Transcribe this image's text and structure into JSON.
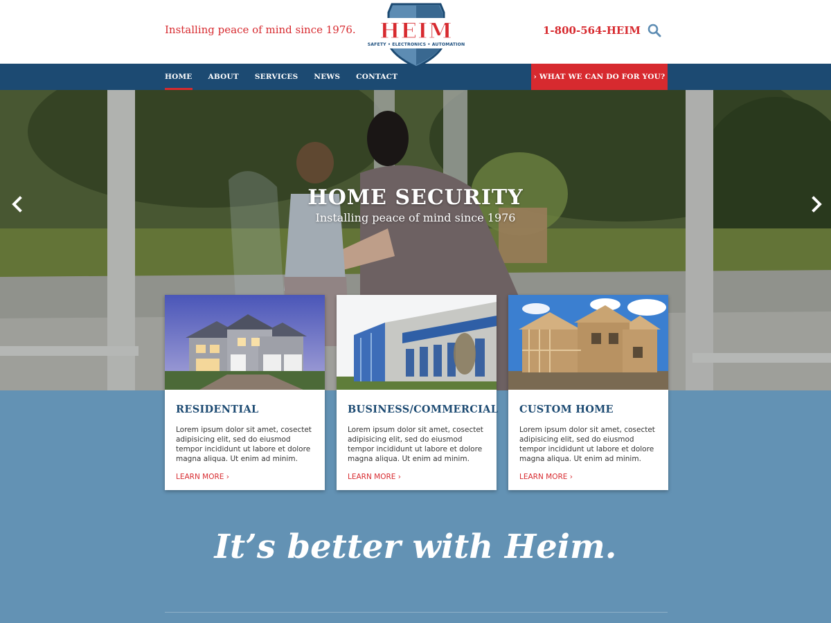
{
  "header": {
    "tagline": "Installing peace of mind since 1976.",
    "phone": "1-800-564-HEIM",
    "search_icon": "search-icon"
  },
  "logo": {
    "word": "HEIM",
    "subtitle": "SAFETY • ELECTRONICS • AUTOMATION"
  },
  "nav": {
    "items": [
      {
        "label": "HOME",
        "active": true
      },
      {
        "label": "ABOUT"
      },
      {
        "label": "SERVICES"
      },
      {
        "label": "NEWS"
      },
      {
        "label": "CONTACT"
      }
    ],
    "cta_label": "› WHAT WE CAN DO FOR YOU?"
  },
  "hero": {
    "title": "HOME SECURITY",
    "subtitle": "Installing peace of mind since 1976",
    "prev_icon": "chevron-left-icon",
    "next_icon": "chevron-right-icon"
  },
  "cards": [
    {
      "title": "RESIDENTIAL",
      "text": "Lorem ipsum dolor sit amet, cosectet adipisicing elit, sed do eiusmod tempor incididunt ut labore et dolore magna aliqua. Ut enim ad minim.",
      "link": "LEARN MORE ›"
    },
    {
      "title": "BUSINESS/COMMERCIAL",
      "text": "Lorem ipsum dolor sit amet, cosectet adipisicing elit, sed do eiusmod tempor incididunt ut labore et dolore magna aliqua. Ut enim ad minim.",
      "link": "LEARN MORE ›"
    },
    {
      "title": "CUSTOM HOME",
      "text": "Lorem ipsum dolor sit amet, cosectet adipisicing elit, sed do eiusmod tempor incididunt ut labore et dolore magna aliqua. Ut enim ad minim.",
      "link": "LEARN MORE ›"
    }
  ],
  "slogan": "It’s better with Heim.",
  "colors": {
    "brand_red": "#d72a2f",
    "brand_navy": "#1c4a72",
    "section_blue": "#6392b4"
  }
}
